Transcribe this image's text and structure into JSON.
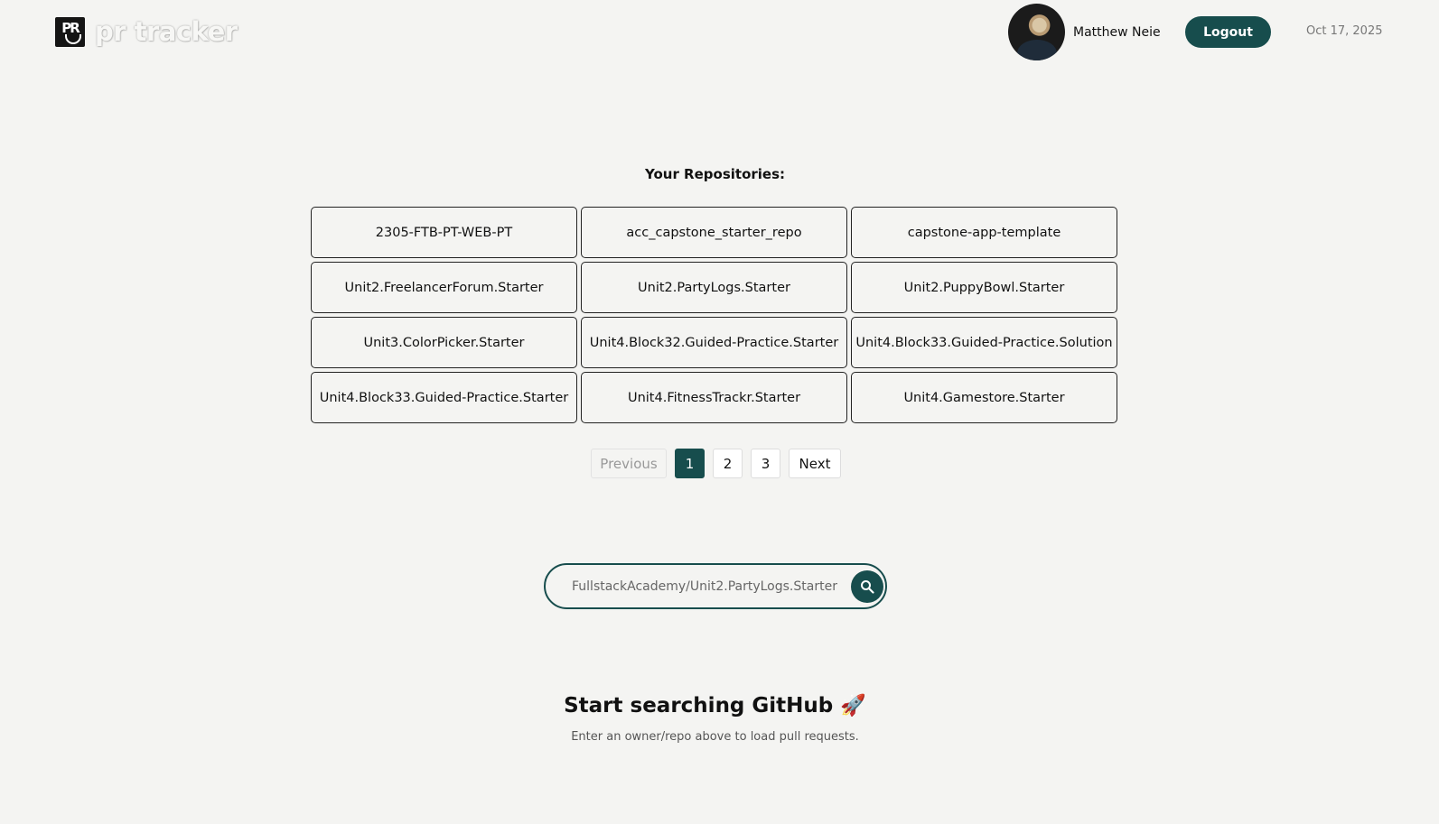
{
  "header": {
    "logo_mark": "PR",
    "logo_text": "pr tracker",
    "user_name": "Matthew Neie",
    "logout_label": "Logout",
    "date": "Oct 17, 2025"
  },
  "repos": {
    "title": "Your Repositories:",
    "items": [
      "2305-FTB-PT-WEB-PT",
      "acc_capstone_starter_repo",
      "capstone-app-template",
      "Unit2.FreelancerForum.Starter",
      "Unit2.PartyLogs.Starter",
      "Unit2.PuppyBowl.Starter",
      "Unit3.ColorPicker.Starter",
      "Unit4.Block32.Guided-Practice.Starter",
      "Unit4.Block33.Guided-Practice.Solution",
      "Unit4.Block33.Guided-Practice.Starter",
      "Unit4.FitnessTrackr.Starter",
      "Unit4.Gamestore.Starter"
    ]
  },
  "pagination": {
    "previous": "Previous",
    "pages": [
      "1",
      "2",
      "3"
    ],
    "current": "1",
    "next": "Next"
  },
  "search": {
    "placeholder": "FullstackAcademy/Unit2.PartyLogs.Starter",
    "icon": "search-icon"
  },
  "empty_state": {
    "title": "Start searching GitHub 🚀",
    "subtitle": "Enter an owner/repo above to load pull requests."
  },
  "colors": {
    "accent": "#174d4d",
    "background": "#f4f4f2"
  }
}
